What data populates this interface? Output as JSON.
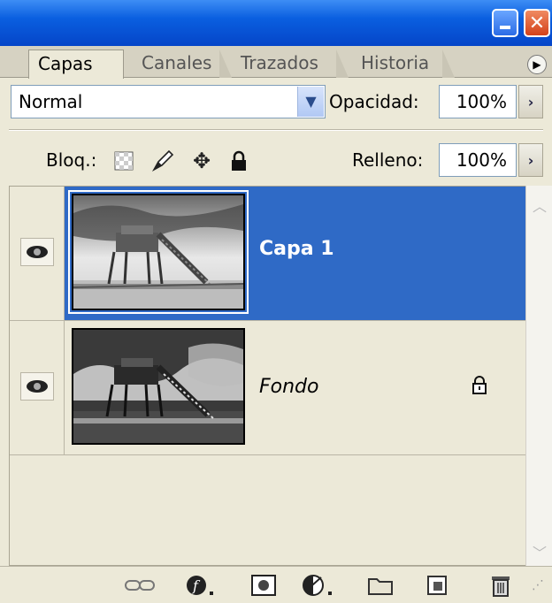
{
  "window": {
    "minimize_icon": "minimize-icon",
    "close_label": "✕"
  },
  "tabs": [
    {
      "label": "Capas",
      "active": true
    },
    {
      "label": "Canales",
      "active": false
    },
    {
      "label": "Trazados",
      "active": false
    },
    {
      "label": "Historia",
      "active": false
    }
  ],
  "blend": {
    "mode": "Normal",
    "opacity_label": "Opacidad:",
    "opacity_value": "100%"
  },
  "lock": {
    "label": "Bloq.:",
    "fill_label": "Relleno:",
    "fill_value": "100%"
  },
  "layers": [
    {
      "name": "Capa 1",
      "selected": true,
      "visible": true,
      "locked": false
    },
    {
      "name": "Fondo",
      "selected": false,
      "visible": true,
      "locked": true
    }
  ],
  "colors": {
    "selection": "#2f6ac6",
    "panel": "#ece9d8",
    "titlebar": "#0a5fe0"
  },
  "footer_icons": [
    "link-layers-icon",
    "layer-style-icon",
    "layer-mask-icon",
    "adjustment-layer-icon",
    "new-group-icon",
    "new-layer-icon",
    "delete-layer-icon"
  ]
}
